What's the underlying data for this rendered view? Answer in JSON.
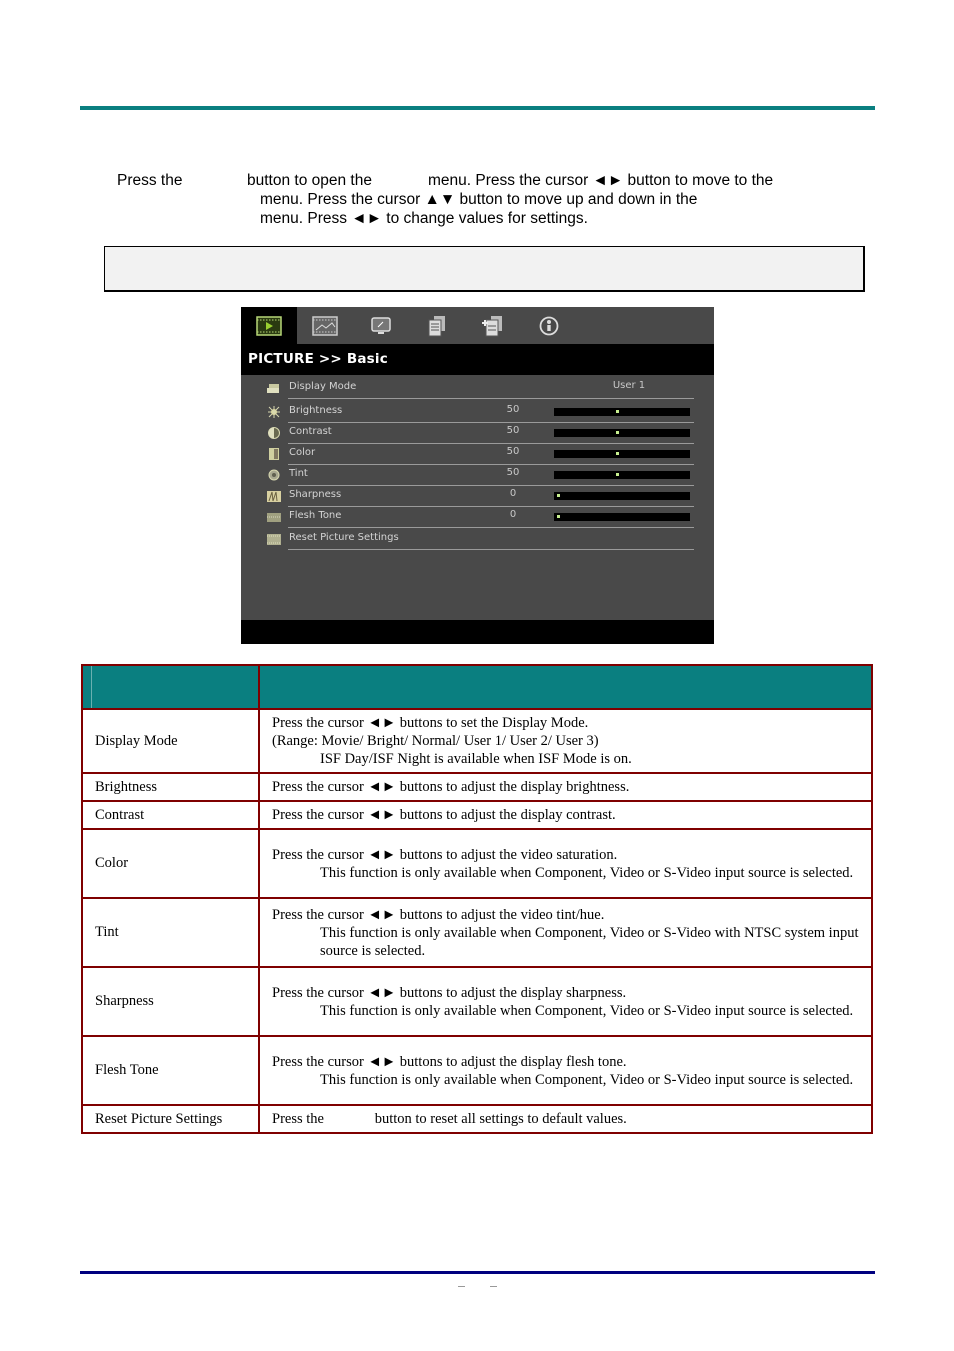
{
  "intro": {
    "line1_a": "Press the",
    "line1_b": "button to open the",
    "line1_c": "menu. Press the cursor ◄► button to move to the",
    "line2": "menu. Press the cursor ▲▼ button to move up and down in the",
    "line3": "menu. Press ◄► to change values for settings."
  },
  "osd": {
    "tabs": [
      {
        "icon": "picture-icon",
        "active": true
      },
      {
        "icon": "computer-picture-icon",
        "active": false
      },
      {
        "icon": "display-icon",
        "active": false
      },
      {
        "icon": "setup-basic-icon",
        "active": false
      },
      {
        "icon": "setup-advanced-icon",
        "active": false
      },
      {
        "icon": "info-icon",
        "active": false
      }
    ],
    "title": "PICTURE >> Basic",
    "items": [
      {
        "label": "Display Mode",
        "value": "User 1",
        "icon": "display-mode-icon"
      },
      {
        "label": "Brightness",
        "value": "50",
        "level": 0.5,
        "icon": "brightness-icon"
      },
      {
        "label": "Contrast",
        "value": "50",
        "level": 0.5,
        "icon": "contrast-icon"
      },
      {
        "label": "Color",
        "value": "50",
        "level": 0.5,
        "icon": "color-icon"
      },
      {
        "label": "Tint",
        "value": "50",
        "level": 0.5,
        "icon": "tint-icon"
      },
      {
        "label": "Sharpness",
        "value": "0",
        "level": 0,
        "icon": "sharpness-icon"
      },
      {
        "label": "Flesh Tone",
        "value": "0",
        "level": 0,
        "icon": "flesh-tone-icon"
      },
      {
        "label": "Reset Picture Settings",
        "value": "",
        "icon": "reset-icon"
      }
    ]
  },
  "table": {
    "rows": [
      {
        "name": "Display Mode",
        "lines": [
          "Press the cursor ◄► buttons to set the Display Mode.",
          "(Range: Movie/ Bright/ Normal/ User 1/ User 2/ User 3)"
        ],
        "note": "ISF Day/ISF Night is available when ISF Mode is on."
      },
      {
        "name": "Brightness",
        "lines": [
          "Press the cursor ◄► buttons to adjust the display brightness."
        ],
        "note": ""
      },
      {
        "name": "Contrast",
        "lines": [
          "Press the cursor ◄► buttons to adjust the display contrast."
        ],
        "note": ""
      },
      {
        "name": "Color",
        "lines": [
          "Press the cursor ◄► buttons to adjust the video saturation."
        ],
        "note": "This function is only available when Component, Video or S-Video input source is selected."
      },
      {
        "name": "Tint",
        "lines": [
          "Press the cursor ◄► buttons to adjust the video tint/hue."
        ],
        "note": "This function is only available when Component, Video or S-Video with NTSC system input source is selected."
      },
      {
        "name": "Sharpness",
        "lines": [
          "Press the cursor ◄► buttons to adjust the display sharpness."
        ],
        "note": "This function is only available when Component, Video or S-Video input source is selected."
      },
      {
        "name": "Flesh Tone",
        "lines": [
          "Press the cursor ◄► buttons to adjust the display flesh tone."
        ],
        "note": "This function is only available when Component, Video or S-Video input source is selected."
      },
      {
        "name": "Reset Picture Settings",
        "lines": [
          "Press the              button to reset all settings to default values."
        ],
        "note": ""
      }
    ]
  },
  "colors": {
    "teal": "#0a7f80",
    "navy": "#00007f",
    "table_border": "#7f0000",
    "osd_bg": "#494949",
    "slider_thumb": "#c8f090"
  }
}
